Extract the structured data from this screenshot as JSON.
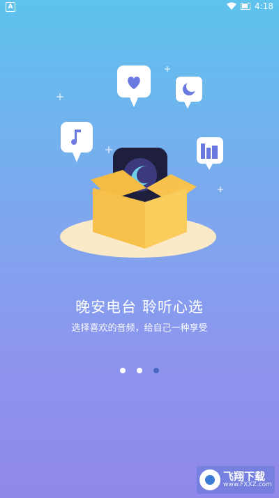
{
  "status_bar": {
    "left_badge": "A",
    "time": "4:18",
    "battery_icon": "battery-icon",
    "wifi_icon": "wifi-icon"
  },
  "onboarding": {
    "title": "晚安电台 聆听心选",
    "subtitle": "选择喜欢的音频，给自己一种享受",
    "page_indicator": {
      "current": 3,
      "total": 3
    }
  },
  "illustration": {
    "items": [
      "heart-icon",
      "moon-icon",
      "music-note-icon",
      "city-icon",
      "app-icon",
      "open-box"
    ]
  },
  "watermark": {
    "brand": "飞翔下载",
    "url": "www.FXXZ.com"
  },
  "colors": {
    "bg_top": "#5ec3ee",
    "bg_bottom": "#9088ea",
    "dot_active": "#4c69c2",
    "box": "#f8c24d"
  }
}
